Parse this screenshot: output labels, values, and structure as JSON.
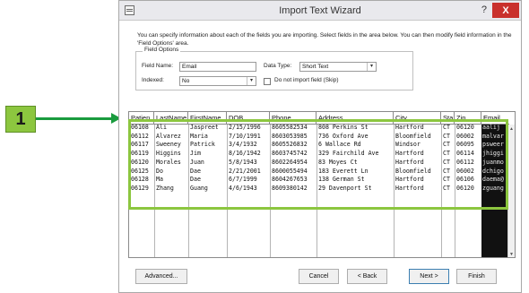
{
  "callout": {
    "number": "1"
  },
  "window": {
    "title": "Import Text Wizard",
    "help_glyph": "?",
    "close_glyph": "X"
  },
  "intro_text": "You can specify information about each of the fields you are importing. Select fields in the area below. You can then modify field information in the 'Field Options' area.",
  "field_options": {
    "legend": "Field Options",
    "field_name_label": "Field Name:",
    "field_name_value": "Email",
    "data_type_label": "Data Type:",
    "data_type_value": "Short Text",
    "indexed_label": "Indexed:",
    "indexed_value": "No",
    "skip_label": "Do not import field (Skip)"
  },
  "grid": {
    "headers": [
      "Patien",
      "LastName",
      "FirstName",
      "DOB",
      "Phone",
      "Address",
      "City",
      "Sta",
      "Zip",
      "Email"
    ],
    "rows": [
      [
        "06108",
        "Ali",
        "Jaspreet",
        "2/15/1996",
        "8605582534",
        "808 Perkins St",
        "Hartford",
        "CT",
        "06120",
        "aalij"
      ],
      [
        "06112",
        "Alvarez",
        "Maria",
        "7/10/1991",
        "8603053985",
        "736 Oxford Ave",
        "Bloomfield",
        "CT",
        "06002",
        "malvar"
      ],
      [
        "06117",
        "Sweeney",
        "Patrick",
        "3/4/1932",
        "8605526832",
        "6 Wallace Rd",
        "Windsor",
        "CT",
        "06095",
        "psweer"
      ],
      [
        "06119",
        "Higgins",
        "Jim",
        "8/16/1942",
        "8603745742",
        "329 Fairchild Ave",
        "Hartford",
        "CT",
        "06114",
        "jhiggi"
      ],
      [
        "06120",
        "Morales",
        "Juan",
        "5/8/1943",
        "8602264954",
        "83 Moyes Ct",
        "Hartford",
        "CT",
        "06112",
        "juanmo"
      ],
      [
        "06125",
        "Do",
        "Dae",
        "2/21/2001",
        "8600055494",
        "183 Everett Ln",
        "Bloomfield",
        "CT",
        "06002",
        "dchigo"
      ],
      [
        "06128",
        "Ma",
        "Dae",
        "6/7/1999",
        "8604267653",
        "138 German St",
        "Hartford",
        "CT",
        "06106",
        "daema@"
      ],
      [
        "06129",
        "Zhang",
        "Guang",
        "4/6/1943",
        "8609380142",
        "29 Davenport St",
        "Hartford",
        "CT",
        "06120",
        "zguang"
      ]
    ]
  },
  "buttons": {
    "advanced": "Advanced...",
    "cancel": "Cancel",
    "back": "< Back",
    "next": "Next >",
    "finish": "Finish"
  },
  "colors": {
    "callout_green": "#8cc63f",
    "arrow_green": "#1a9b3e",
    "close_red": "#c9302c",
    "selected_column": "#111111"
  }
}
